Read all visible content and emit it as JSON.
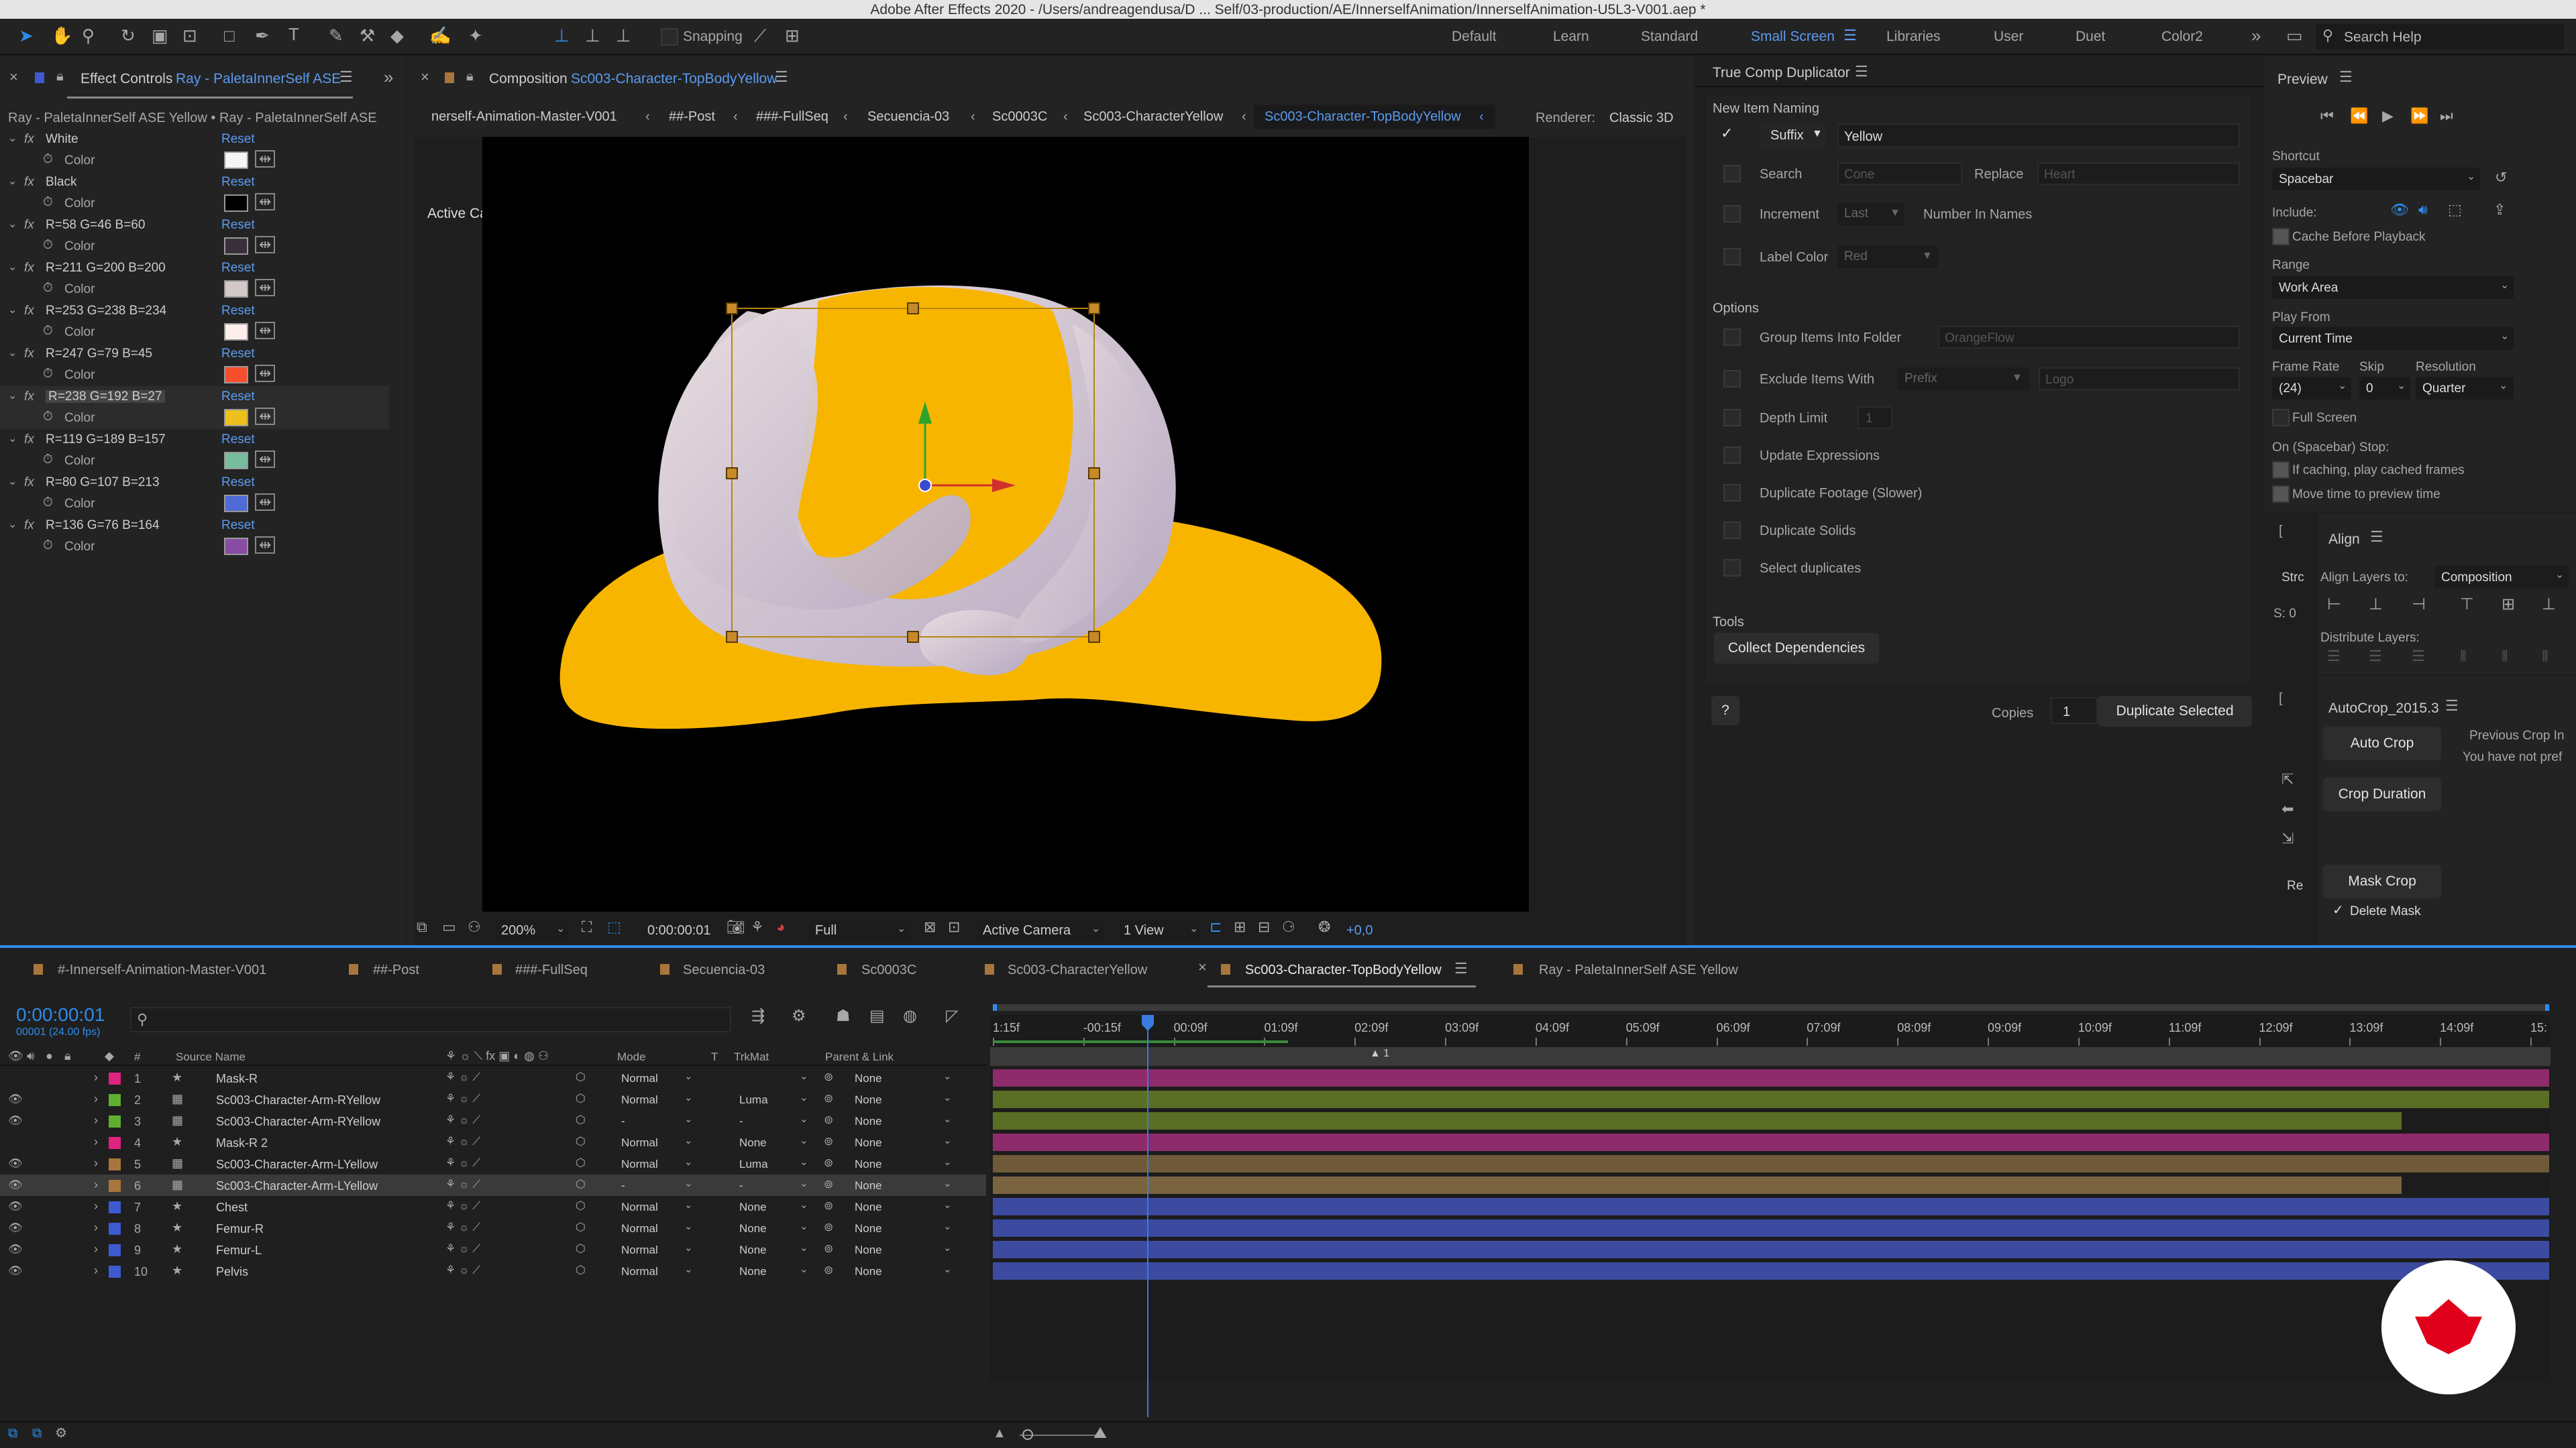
{
  "app": {
    "title": "Adobe After Effects 2020 - /Users/andreagendusa/D ... Self/03-production/AE/InnerselfAnimation/InnerselfAnimation-U5L3-V001.aep *"
  },
  "toolbar": {
    "snapping": "Snapping"
  },
  "workspaces": [
    "Default",
    "Learn",
    "Standard",
    "Small Screen",
    "Libraries",
    "User",
    "Duet",
    "Color2"
  ],
  "active_workspace": "Small Screen",
  "search": {
    "placeholder": "Search Help"
  },
  "effect_controls": {
    "tab_prefix": "Effect Controls",
    "tab_layer": "Ray - PaletaInnerSelf ASE",
    "subtitle": "Ray - PaletaInnerSelf ASE Yellow • Ray - PaletaInnerSelf ASE",
    "reset": "Reset",
    "color_label": "Color",
    "effects": [
      {
        "name": "White",
        "swatch": "#f5f5f5"
      },
      {
        "name": "Black",
        "swatch": "#000000"
      },
      {
        "name": "R=58 G=46 B=60",
        "swatch": "#3a2e3c"
      },
      {
        "name": "R=211 G=200 B=200",
        "swatch": "#d3c8c8"
      },
      {
        "name": "R=253 G=238 B=234",
        "swatch": "#fdeeea"
      },
      {
        "name": "R=247 G=79 B=45",
        "swatch": "#f74f2d"
      },
      {
        "name": "R=238 G=192 B=27",
        "swatch": "#eec01b"
      },
      {
        "name": "R=119 G=189 B=157",
        "swatch": "#77bd9d"
      },
      {
        "name": "R=80 G=107 B=213",
        "swatch": "#506bd5"
      },
      {
        "name": "R=136 G=76 B=164",
        "swatch": "#884ca4"
      }
    ]
  },
  "composition": {
    "tab_prefix": "Composition",
    "tab_name": "Sc003-Character-TopBodyYellow",
    "breadcrumbs": [
      "nerself-Animation-Master-V001",
      "##-Post",
      "###-FullSeq",
      "Secuencia-03",
      "Sc0003C",
      "Sc003-CharacterYellow",
      "Sc003-Character-TopBodyYellow"
    ],
    "renderer_label": "Renderer:",
    "renderer": "Classic 3D",
    "camera_label": "Active Camera",
    "bottom": {
      "zoom": "200%",
      "timecode": "0:00:00:01",
      "resolution": "Full",
      "camera": "Active Camera",
      "views": "1 View",
      "exposure": "+0,0"
    }
  },
  "tcd": {
    "title": "True Comp Duplicator",
    "new_item_naming": "New Item Naming",
    "suffix": "Suffix",
    "suffix_value": "Yellow",
    "search": "Search",
    "search_ph": "Cone",
    "replace": "Replace",
    "replace_ph": "Heart",
    "increment": "Increment",
    "increment_value": "Last",
    "number_in_names": "Number In Names",
    "label_color": "Label Color",
    "label_color_value": "Red",
    "options": "Options",
    "group_items": "Group Items Into Folder",
    "group_ph": "OrangeFlow",
    "exclude": "Exclude Items With",
    "exclude_value": "Prefix",
    "exclude_ph": "Logo",
    "depth_limit": "Depth Limit",
    "depth_value": "1",
    "update_expr": "Update Expressions",
    "dup_footage": "Duplicate Footage (Slower)",
    "dup_solids": "Duplicate Solids",
    "select_dups": "Select duplicates",
    "tools": "Tools",
    "collect_deps": "Collect Dependencies",
    "help": "?",
    "copies_label": "Copies",
    "copies_value": "1",
    "dup_selected": "Duplicate Selected"
  },
  "preview": {
    "title": "Preview",
    "shortcut_label": "Shortcut",
    "shortcut": "Spacebar",
    "include_label": "Include:",
    "cache_before": "Cache Before Playback",
    "range_label": "Range",
    "range": "Work Area",
    "play_from_label": "Play From",
    "play_from": "Current Time",
    "frame_rate_label": "Frame Rate",
    "frame_rate": "(24)",
    "skip_label": "Skip",
    "skip": "0",
    "resolution_label": "Resolution",
    "resolution": "Quarter",
    "full_screen": "Full Screen",
    "on_stop": "On (Spacebar) Stop:",
    "if_caching": "If caching, play cached frames",
    "move_time": "Move time to preview time"
  },
  "align": {
    "title": "Align",
    "align_to_label": "Align Layers to:",
    "align_to": "Composition",
    "distribute_label": "Distribute Layers:",
    "side_tab_a": "Strc",
    "side_tab_b": "S: 0",
    "side_tab_c": "Re"
  },
  "autocrop": {
    "title": "AutoCrop_2015.3",
    "auto_crop": "Auto Crop",
    "crop_duration": "Crop Duration",
    "mask_crop": "Mask Crop",
    "delete_mask": "Delete Mask",
    "prev_crop": "Previous Crop In",
    "no_pref": "You have not pref"
  },
  "timeline": {
    "tabs": [
      "#-Innerself-Animation-Master-V001",
      "##-Post",
      "###-FullSeq",
      "Secuencia-03",
      "Sc0003C",
      "Sc003-CharacterYellow",
      "Sc003-Character-TopBodyYellow",
      "Ray - PaletaInnerSelf ASE Yellow"
    ],
    "active_tab": "Sc003-Character-TopBodyYellow",
    "timecode": "0:00:00:01",
    "fps": "00001 (24.00 fps)",
    "headers": {
      "num": "#",
      "source": "Source Name",
      "mode": "Mode",
      "t": "T",
      "trkmat": "TrkMat",
      "parent": "Parent & Link"
    },
    "ruler": [
      "1:15f",
      "-00:15f",
      "00:09f",
      "01:09f",
      "02:09f",
      "03:09f",
      "04:09f",
      "05:09f",
      "06:09f",
      "07:09f",
      "08:09f",
      "09:09f",
      "10:09f",
      "11:09f",
      "12:09f",
      "13:09f",
      "14:09f",
      "15:"
    ],
    "layers": [
      {
        "num": "1",
        "name": "Mask-R",
        "label": "#e0237e",
        "mode": "Normal",
        "trkmat": "",
        "parent": "None",
        "bar": "#8e2b6b"
      },
      {
        "num": "2",
        "name": "Sc003-Character-Arm-RYellow",
        "label": "#5fae2f",
        "mode": "Normal",
        "trkmat": "Luma",
        "parent": "None",
        "bar": "#5b6e25"
      },
      {
        "num": "3",
        "name": "Sc003-Character-Arm-RYellow",
        "label": "#5fae2f",
        "mode": "-",
        "trkmat": "-",
        "parent": "None",
        "bar": "#5b6e25"
      },
      {
        "num": "4",
        "name": "Mask-R 2",
        "label": "#e0237e",
        "mode": "Normal",
        "trkmat": "None",
        "parent": "None",
        "bar": "#8e2b6b"
      },
      {
        "num": "5",
        "name": "Sc003-Character-Arm-LYellow",
        "label": "#a8763c",
        "mode": "Normal",
        "trkmat": "Luma",
        "parent": "None",
        "bar": "#6e5a38"
      },
      {
        "num": "6",
        "name": "Sc003-Character-Arm-LYellow",
        "label": "#a8763c",
        "mode": "-",
        "trkmat": "-",
        "parent": "None",
        "bar": "#7a6440"
      },
      {
        "num": "7",
        "name": "Chest",
        "label": "#3d5ad1",
        "mode": "Normal",
        "trkmat": "None",
        "parent": "None",
        "bar": "#3c4aa0"
      },
      {
        "num": "8",
        "name": "Femur-R",
        "label": "#3d5ad1",
        "mode": "Normal",
        "trkmat": "None",
        "parent": "None",
        "bar": "#3c4aa0"
      },
      {
        "num": "9",
        "name": "Femur-L",
        "label": "#3d5ad1",
        "mode": "Normal",
        "trkmat": "None",
        "parent": "None",
        "bar": "#3c4aa0"
      },
      {
        "num": "10",
        "name": "Pelvis",
        "label": "#3d5ad1",
        "mode": "Normal",
        "trkmat": "None",
        "parent": "None",
        "bar": "#3c4aa0"
      }
    ]
  },
  "colors": {
    "accent": "#2d8ceb",
    "character_yellow": "#f7b500",
    "character_skin": "#d9ccd4"
  }
}
